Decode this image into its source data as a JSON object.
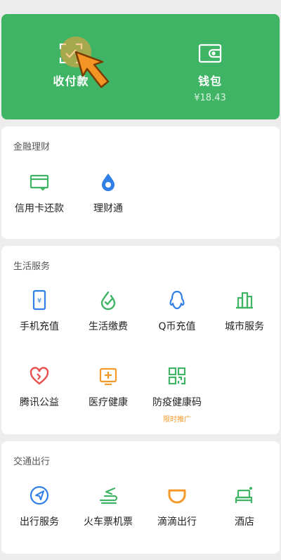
{
  "top": {
    "pay": {
      "label": "收付款",
      "icon": "scan-check-icon"
    },
    "wallet": {
      "label": "钱包",
      "balance": "¥18.43",
      "icon": "wallet-icon"
    }
  },
  "finance": {
    "title": "金融理财",
    "items": [
      {
        "label": "信用卡还款",
        "icon": "credit-card-icon"
      },
      {
        "label": "理财通",
        "icon": "drop-icon"
      }
    ]
  },
  "life": {
    "title": "生活服务",
    "items": [
      {
        "label": "手机充值",
        "icon": "phone-recharge-icon"
      },
      {
        "label": "生活缴费",
        "icon": "utility-bill-icon"
      },
      {
        "label": "Q币充值",
        "icon": "qq-penguin-icon"
      },
      {
        "label": "城市服务",
        "icon": "city-buildings-icon"
      },
      {
        "label": "腾讯公益",
        "icon": "charity-heart-icon"
      },
      {
        "label": "医疗健康",
        "icon": "medical-cross-icon"
      },
      {
        "label": "防疫健康码",
        "icon": "qr-code-icon",
        "badge": "限时推广"
      }
    ]
  },
  "transport": {
    "title": "交通出行",
    "items": [
      {
        "label": "出行服务",
        "icon": "compass-icon"
      },
      {
        "label": "火车票机票",
        "icon": "train-plane-icon"
      },
      {
        "label": "滴滴出行",
        "icon": "didi-icon"
      },
      {
        "label": "酒店",
        "icon": "hotel-bed-icon"
      }
    ]
  },
  "colors": {
    "green": "#3fb465",
    "blue": "#2f7fe6",
    "orange": "#f39a2b",
    "red": "#e94f4f"
  }
}
